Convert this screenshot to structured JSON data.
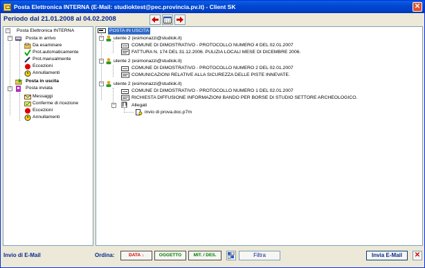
{
  "window": {
    "title": "Posta Elettronica INTERNA (E-Mail: studioktest@pec.provincia.pv.it) - Client SK"
  },
  "period": "Periodo dal 21.01.2008 al 04.02.2008",
  "left_tree": {
    "root": "Posta Elettronica INTERNA",
    "arrivo": "Posta in arrivo",
    "da_esaminare": "Da esaminare",
    "prot_auto": "Prot.automaticamente",
    "prot_man": "Prot.manualmente",
    "eccezioni1": "Eccezioni",
    "annullamenti1": "Annullamenti",
    "uscita": "Posta in uscita",
    "inviata": "Posta inviata",
    "messaggi": "Messaggi",
    "conferme": "Conferme di ricezione",
    "eccezioni2": "Eccezioni",
    "annullamenti2": "Annullamenti"
  },
  "right_tree": {
    "root": "POSTA IN USCITA",
    "user1": "utente 2 (esimonazzi@studiok.it)",
    "u1_prot": "COMUNE DI DIMOSTRATIVO - PROTOCOLLO NUMERO 4 DEL 02.01.2007",
    "u1_subj": "FATTURA  N.  174  DEL  31.12.2006. PULIZIA LOCALI MESE DI DICEMBRE 2006.",
    "user2": "utente 2 (esimonazzi@studiok.it)",
    "u2_prot": "COMUNE DI DIMOSTRATIVO - PROTOCOLLO NUMERO 2 DEL 02.01.2007",
    "u2_subj": "COMUNICAZIONI RELATIVE ALLA SICUREZZA DELLE PISTE INNEVATE.",
    "user3": "utente 2 (esimonazzi@studiok.it)",
    "u3_prot": "COMUNE DI DIMOSTRATIVO - PROTOCOLLO NUMERO 1 DEL 02.01.2007",
    "u3_subj": "RICHIESTA DIFFUSIONE INFORMAZIONI BANDO PER BORSE DI STUDIO SETTORE ARCHEOLOGICO.",
    "allegati": "Allegati",
    "attachment": "invio di prova.doc.p7m"
  },
  "bottom": {
    "invio": "Invio di E-Mail",
    "ordina": "Ordina:",
    "data": "DATA",
    "data_arrow": "↓",
    "oggetto": "OGGETTO",
    "mitdes": "MIT. / DES.",
    "filtra": "Filtra",
    "invia": "Invia E-Mail"
  },
  "colors": {
    "accent": "#0a2a8e",
    "selection": "#316ac5",
    "sort_data": "#cc0000",
    "sort_oggetto": "#007a00",
    "sort_mitdes": "#007a00"
  },
  "icons": [
    "app-icon",
    "close-icon",
    "prev-arrow-icon",
    "calendar-icon",
    "next-arrow-icon",
    "mailbox-icon",
    "folder-icon",
    "user-icon",
    "document-icon",
    "attachment-icon",
    "warning-icon",
    "stop-icon",
    "filter-toggle-icon"
  ]
}
